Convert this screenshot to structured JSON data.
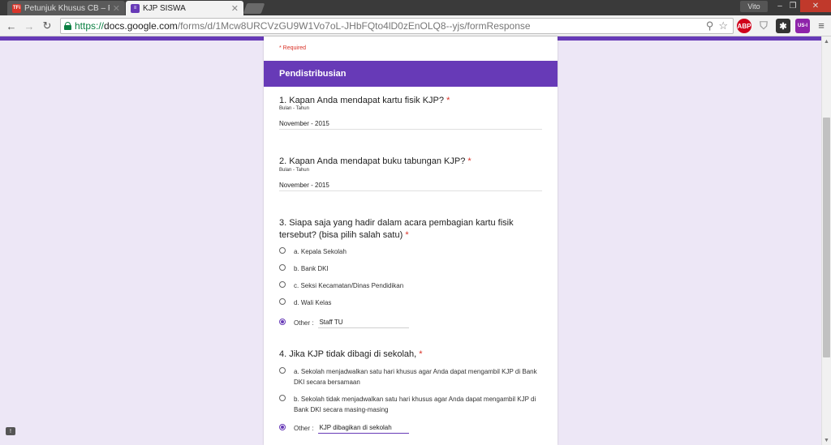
{
  "browser": {
    "tabs": [
      {
        "title": "Petunjuk Khusus CB – Profi",
        "favicon": "TFi",
        "favicon_color": "#d9352a"
      },
      {
        "title": "KJP SISWA",
        "favicon": "forms-icon",
        "favicon_color": "#673ab7"
      }
    ],
    "user": "Vito",
    "url": {
      "scheme": "https://",
      "host": "docs.google.com",
      "path": "/forms/d/1Mcw8URCVzGU9W1Vo7oL-JHbFQto4lD0zEnOLQ8--yjs/formResponse"
    },
    "extensions": [
      {
        "name": "adblock-plus-icon",
        "label": "ABP",
        "color": "#d0021b"
      },
      {
        "name": "shield-extension-icon",
        "label": "",
        "color": "#9e9e9e"
      },
      {
        "name": "puzzle-extension-icon",
        "label": "",
        "color": "#333333"
      },
      {
        "name": "us-extension-icon",
        "label": "US-I",
        "color": "#8e24aa"
      }
    ]
  },
  "form": {
    "accent": "#673ab7",
    "required_note": "* Required",
    "section_title": "Pendistribusian",
    "questions": [
      {
        "title": "1. Kapan Anda mendapat kartu fisik KJP?",
        "star": "*",
        "help": "Bulan - Tahun",
        "answer": "November - 2015"
      },
      {
        "title": "2. Kapan Anda mendapat buku tabungan KJP?",
        "star": "*",
        "help": "Bulan - Tahun",
        "answer": "November - 2015"
      },
      {
        "title": "3. Siapa saja yang hadir dalam acara pembagian kartu fisik tersebut? (bisa pilih salah satu)",
        "star": "*",
        "options": [
          "a. Kepala Sekolah",
          "b. Bank DKI",
          "c. Seksi Kecamatan/Dinas Pendidikan",
          "d. Wali Kelas"
        ],
        "other_label": "Other :",
        "other_value": "Staff TU"
      },
      {
        "title": "4. Jika KJP tidak dibagi di sekolah,",
        "star": "*",
        "options": [
          "a. Sekolah menjadwalkan satu hari khusus agar Anda dapat mengambil KJP di Bank DKI secara bersamaan",
          "b. Sekolah tidak menjadwalkan satu hari khusus agar Anda dapat mengambil KJP di Bank DKI secara masing-masing"
        ],
        "other_label": "Other :",
        "other_value": "KJP dibagikan di sekolah"
      }
    ]
  }
}
